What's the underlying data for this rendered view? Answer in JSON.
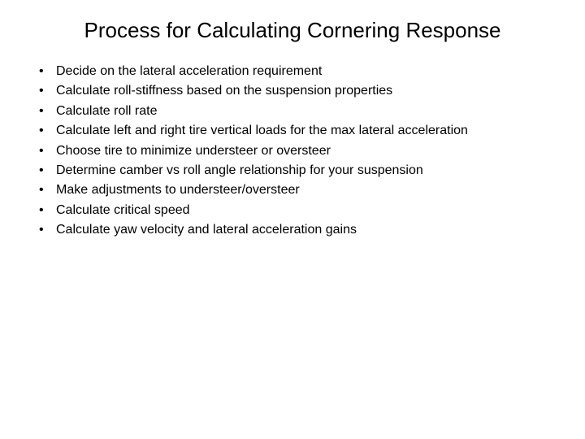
{
  "title": "Process for Calculating Cornering Response",
  "items": [
    "Decide on the lateral acceleration requirement",
    "Calculate roll-stiffness based on the suspension properties",
    "Calculate roll rate",
    "Calculate left and right tire vertical loads for the max lateral acceleration",
    "Choose tire to minimize understeer or oversteer",
    "Determine camber vs roll angle relationship for your suspension",
    "Make adjustments to understeer/oversteer",
    "Calculate critical speed",
    "Calculate yaw velocity and lateral acceleration gains"
  ]
}
